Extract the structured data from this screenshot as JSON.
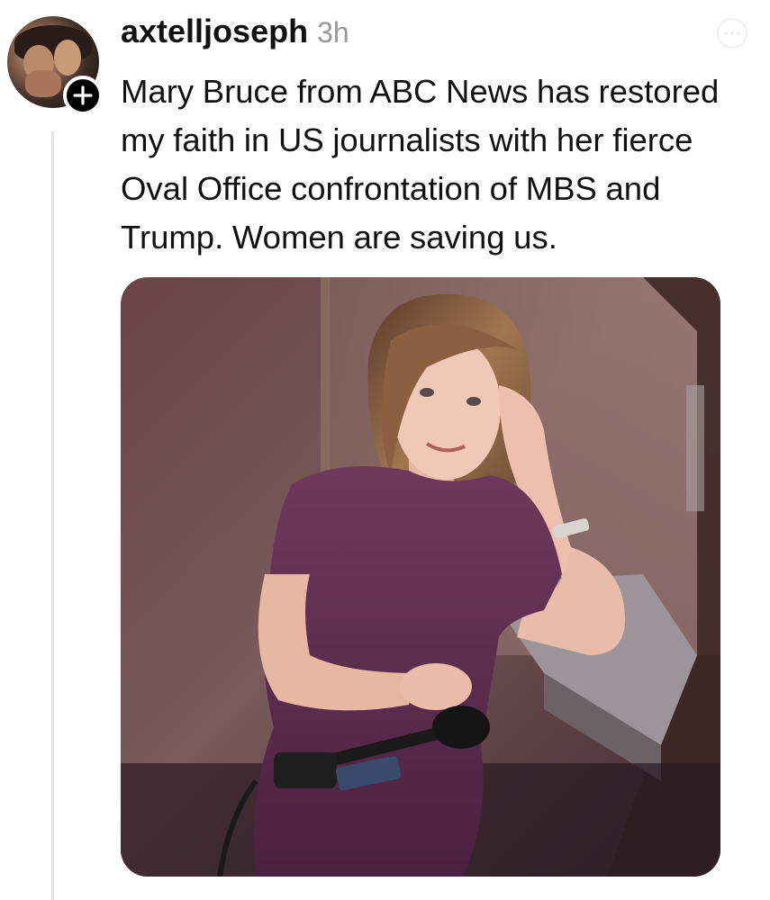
{
  "post": {
    "username": "axtelljoseph",
    "timestamp": "3h",
    "text": "Mary Bruce from ABC News has restored my faith in US journalists with her fierce Oval Office confrontation of MBS and Trump. Women are saving us.",
    "image_alt": "Woman in a purple dress seated in a small booth holding a microphone"
  },
  "icons": {
    "follow": "plus-icon",
    "more": "more-icon"
  },
  "colors": {
    "username": "#111111",
    "timestamp": "#999999",
    "thread_line": "#e3e3e3",
    "follow_badge": "#000000"
  }
}
